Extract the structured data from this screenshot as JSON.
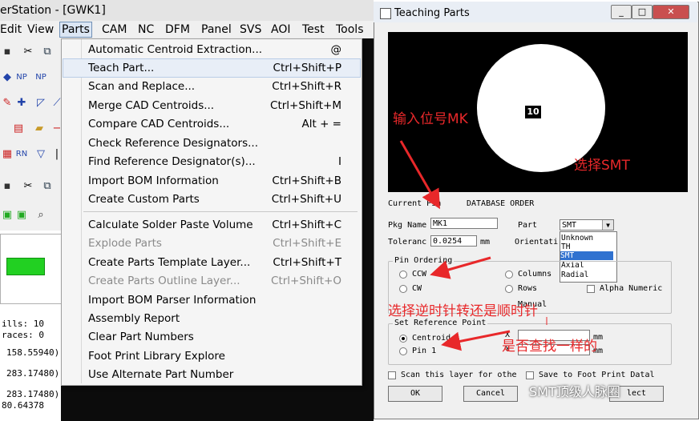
{
  "app": {
    "title": "erStation - [GWK1]"
  },
  "menubar": {
    "items": [
      "Edit",
      "View",
      "Parts",
      "CAM",
      "NC",
      "DFM",
      "Panel",
      "SVS",
      "AOI",
      "Test",
      "Tools"
    ]
  },
  "parts_menu": {
    "items": [
      {
        "label": "Automatic Centroid Extraction...",
        "shortcut": "@",
        "enabled": true
      },
      {
        "label": "Teach Part...",
        "shortcut": "Ctrl+Shift+P",
        "enabled": true
      },
      {
        "label": "Scan and Replace...",
        "shortcut": "Ctrl+Shift+R",
        "enabled": true
      },
      {
        "label": "Merge CAD Centroids...",
        "shortcut": "Ctrl+Shift+M",
        "enabled": true
      },
      {
        "label": "Compare CAD Centroids...",
        "shortcut": "Alt + =",
        "enabled": true
      },
      {
        "label": "Check Reference Designators...",
        "shortcut": "",
        "enabled": true
      },
      {
        "label": "Find Reference Designator(s)...",
        "shortcut": "I",
        "enabled": true
      },
      {
        "label": "Import BOM Information",
        "shortcut": "Ctrl+Shift+B",
        "enabled": true
      },
      {
        "label": "Create Custom Parts",
        "shortcut": "Ctrl+Shift+U",
        "enabled": true
      },
      {
        "label": "Calculate Solder Paste Volume",
        "shortcut": "Ctrl+Shift+C",
        "enabled": true
      },
      {
        "label": "Explode Parts",
        "shortcut": "Ctrl+Shift+E",
        "enabled": false
      },
      {
        "label": "Create Parts Template Layer...",
        "shortcut": "Ctrl+Shift+T",
        "enabled": true
      },
      {
        "label": "Create Parts Outline Layer...",
        "shortcut": "Ctrl+Shift+O",
        "enabled": false
      },
      {
        "label": "Import BOM Parser Information",
        "shortcut": "",
        "enabled": true
      },
      {
        "label": "Assembly Report",
        "shortcut": "",
        "enabled": true
      },
      {
        "label": "Clear Part Numbers",
        "shortcut": "",
        "enabled": true
      },
      {
        "label": "Foot Print Library Explore",
        "shortcut": "",
        "enabled": true
      },
      {
        "label": "Use Alternate Part Number",
        "shortcut": "",
        "enabled": true
      }
    ]
  },
  "left_info": {
    "lines": [
      "ills: 10",
      "races: 0",
      "158.55940)",
      "283.17480)",
      "283.17480)",
      "80.64378"
    ]
  },
  "dialog": {
    "title": "Teaching Parts",
    "preview_pin_number": "10",
    "current_pin_label": "Current Pin",
    "database_order": "DATABASE ORDER",
    "pkg_name_label": "Pkg Name",
    "pkg_name_value": "MK1",
    "part_label": "Part",
    "part_value": "SMT",
    "part_options": [
      "Unknown",
      "TH",
      "SMT",
      "Axial",
      "Radial"
    ],
    "tolerance_label": "Toleranc",
    "tolerance_value": "0.0254",
    "tolerance_unit": "mm",
    "orientation_label": "Orientati",
    "pin_ordering_title": "Pin Ordering",
    "ccw_label": "CCW",
    "cw_label": "CW",
    "columns_label": "Columns",
    "rows_label": "Rows",
    "alpha_numeric_label": "Alpha Numeric",
    "manual_label": "Manual",
    "set_ref_point_title": "Set Reference Point",
    "centroid_label": "Centroid",
    "pin1_label": "Pin 1",
    "x_label": "X",
    "y_label": "Y",
    "coord_unit": "mm",
    "scan_layer_label": "Scan this layer for othe",
    "save_footprint_label": "Save to Foot Print Datal",
    "ok_label": "OK",
    "cancel_label": "Cancel",
    "last_button_label": "lect"
  },
  "annotations": {
    "input_refdes": "输入位号MK",
    "select_smt": "选择SMT",
    "choose_direction": "选择逆时针转还是顺时针",
    "find_same": "是否查找一样的"
  },
  "watermark": "SMT顶级人脉圈"
}
